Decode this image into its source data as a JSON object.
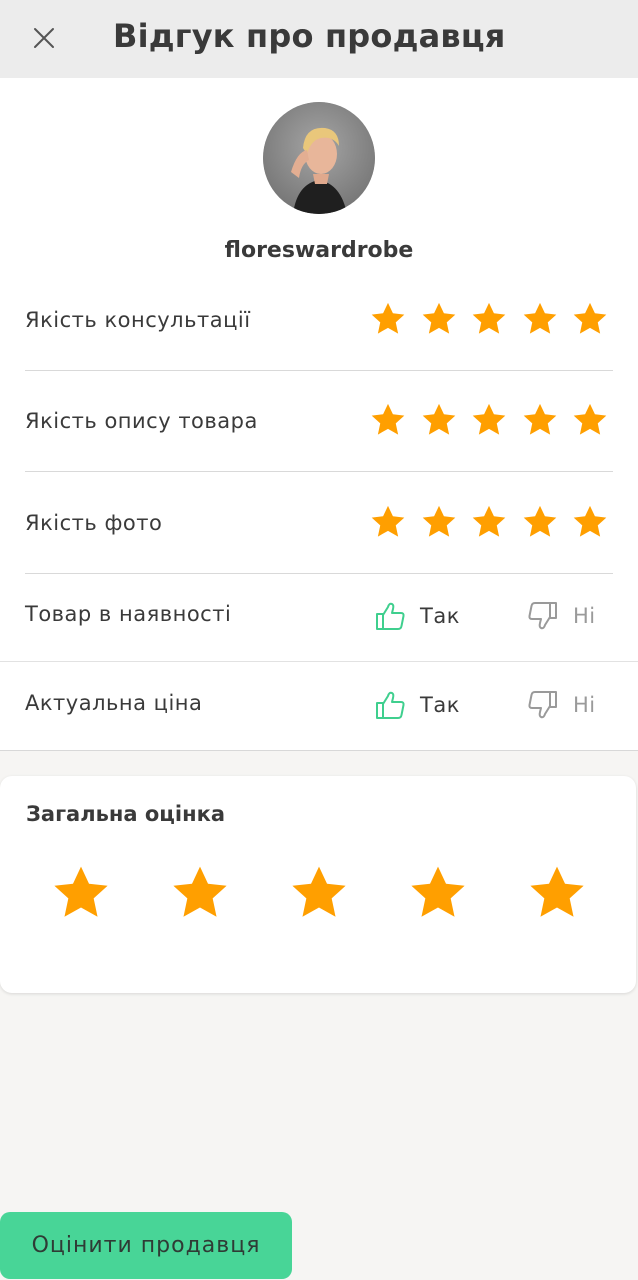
{
  "header": {
    "title": "Відгук про продавця",
    "close_icon": "close-icon"
  },
  "seller": {
    "username": "floreswardrobe",
    "avatar": "avatar-photo"
  },
  "ratings": [
    {
      "label": "Якість консультації",
      "stars": 5,
      "max": 5
    },
    {
      "label": "Якість опису товара",
      "stars": 5,
      "max": 5
    },
    {
      "label": "Якість фото",
      "stars": 5,
      "max": 5
    }
  ],
  "yes_no": [
    {
      "label": "Товар в наявності",
      "yes": "Так",
      "no": "Ні",
      "selected": "yes"
    },
    {
      "label": "Актуальна ціна",
      "yes": "Так",
      "no": "Ні",
      "selected": "yes"
    }
  ],
  "overall": {
    "title": "Загальна оцінка",
    "stars": 5,
    "max": 5
  },
  "submit_label": "Оцінити продавця",
  "colors": {
    "star": "#FF9F00",
    "accent_green": "#48D597",
    "thumb_yes": "#3FCF8E",
    "thumb_no": "#9A9A9A",
    "header_bg": "#ECECEC"
  }
}
